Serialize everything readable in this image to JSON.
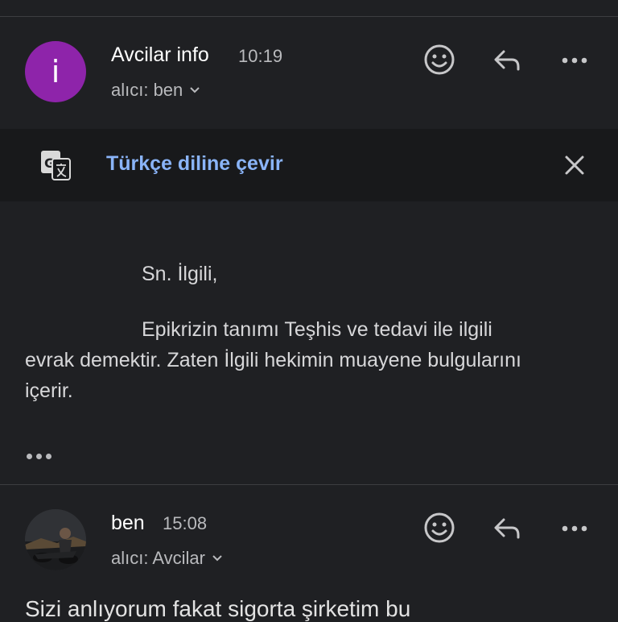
{
  "message1": {
    "avatar_letter": "i",
    "sender": "Avcilar info",
    "time": "10:19",
    "recipient": "alıcı: ben",
    "greeting": "Sn. İlgili,",
    "paragraph_line1": "Epikrizin tanımı Teşhis ve tedavi ile ilgili",
    "paragraph_line2": "evrak demektir. Zaten İlgili hekimin muayene bulgularını",
    "paragraph_line3": "içerir."
  },
  "translate": {
    "label": "Türkçe diline çevir"
  },
  "message2": {
    "sender": "ben",
    "time": "15:08",
    "recipient": "alıcı: Avcilar",
    "preview": "Sizi anlıyorum fakat sigorta şirketim bu"
  },
  "icons": {
    "emoji": "emoji-reaction-icon",
    "reply": "reply-icon",
    "more": "more-horizontal-icon",
    "translate": "google-translate-icon",
    "close": "close-icon",
    "chevron": "chevron-down-icon"
  },
  "colors": {
    "background": "#1f2023",
    "avatar": "#8e24aa",
    "link": "#8ab4f8"
  }
}
